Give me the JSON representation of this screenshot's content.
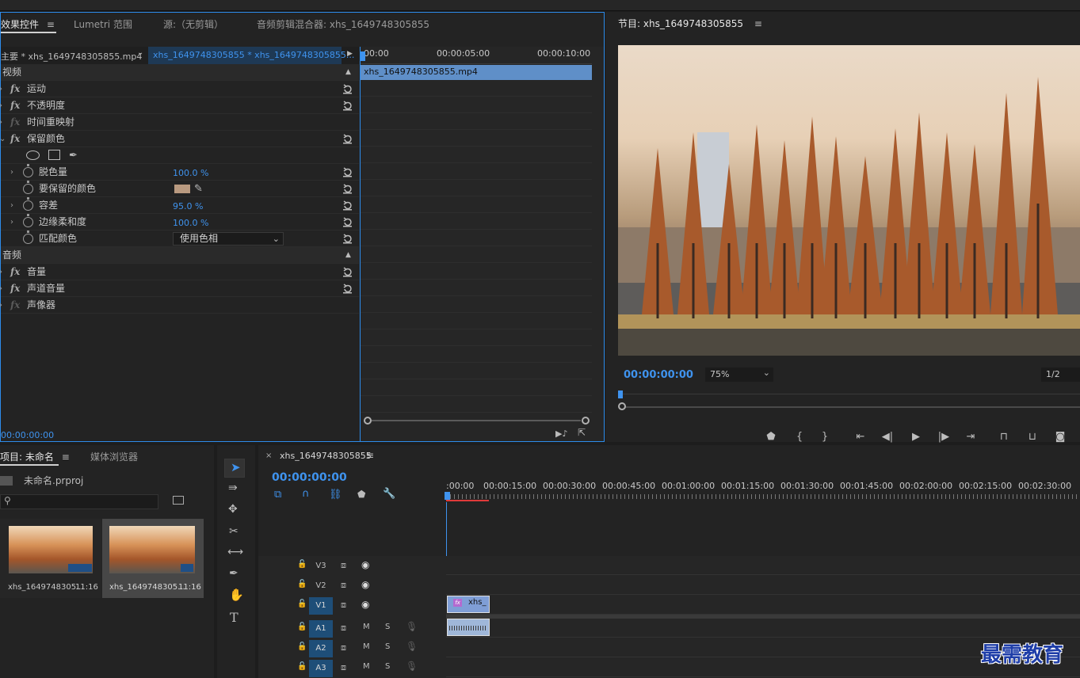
{
  "effects_panel": {
    "tabs": [
      "效果控件",
      "Lumetri 范围",
      "源:（无剪辑）",
      "音频剪辑混合器: xhs_1649748305855"
    ],
    "master_label": "主要 * xhs_1649748305855.mp4",
    "sequence_clip_label": "xhs_1649748305855 * xhs_1649748305855...",
    "ruler": [
      "00:00",
      "00:00:05:00",
      "00:00:10:00"
    ],
    "clip_bar": "xhs_1649748305855.mp4",
    "section_video": "视频",
    "section_audio": "音频",
    "effects": [
      {
        "name": "运动"
      },
      {
        "name": "不透明度"
      },
      {
        "name": "时间重映射"
      },
      {
        "name": "保留颜色"
      }
    ],
    "params": [
      {
        "name": "脱色量",
        "value": "100.0 %"
      },
      {
        "name": "要保留的颜色",
        "value": ""
      },
      {
        "name": "容差",
        "value": "95.0 %"
      },
      {
        "name": "边缘柔和度",
        "value": "100.0 %"
      },
      {
        "name": "匹配颜色",
        "value": "使用色相"
      }
    ],
    "swatch_color": "#b99a80",
    "audio_effects": [
      {
        "name": "音量"
      },
      {
        "name": "声道音量"
      },
      {
        "name": "声像器"
      }
    ],
    "timecode": "00:00:00:00"
  },
  "program_monitor": {
    "title": "节目: xhs_1649748305855",
    "timecode": "00:00:00:00",
    "zoom": "75%",
    "resolution": "1/2"
  },
  "project_panel": {
    "tabs": [
      "项目: 未命名",
      "媒体浏览器"
    ],
    "project_file": "未命名.prproj",
    "search_placeholder": "",
    "items": [
      {
        "name": "xhs_1649748305...",
        "duration": "11:16"
      },
      {
        "name": "xhs_1649748305...",
        "duration": "11:16"
      }
    ]
  },
  "timeline": {
    "tab": "xhs_1649748305855",
    "timecode": "00:00:00:00",
    "ruler": [
      ":00:00",
      "00:00:15:00",
      "00:00:30:00",
      "00:00:45:00",
      "00:01:00:00",
      "00:01:15:00",
      "00:01:30:00",
      "00:01:45:00",
      "00:02:00:00",
      "00:02:15:00",
      "00:02:30:00"
    ],
    "video_tracks": [
      "V3",
      "V2",
      "V1"
    ],
    "audio_tracks": [
      "A1",
      "A2",
      "A3"
    ],
    "mute": "M",
    "solo": "S",
    "clip_label": "xhs_"
  },
  "watermark": "最需教育"
}
